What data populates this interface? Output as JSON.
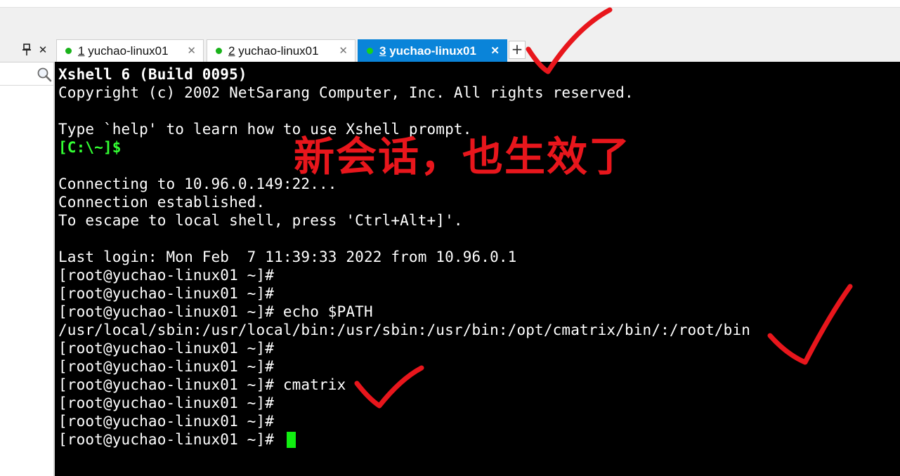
{
  "tabs": [
    {
      "num": "1",
      "label": "yuchao-linux01",
      "active": false
    },
    {
      "num": "2",
      "label": "yuchao-linux01",
      "active": false
    },
    {
      "num": "3",
      "label": "yuchao-linux01",
      "active": true
    }
  ],
  "tab_close_glyph": "✕",
  "add_tab_glyph": "+",
  "left_panel": {
    "pin_glyph": "📌",
    "close_glyph": "✕"
  },
  "terminal": {
    "lines": [
      "Xshell 6 (Build 0095)",
      "Copyright (c) 2002 NetSarang Computer, Inc. All rights reserved.",
      "",
      "Type `help' to learn how to use Xshell prompt.",
      "[C:\\~]$",
      "",
      "Connecting to 10.96.0.149:22...",
      "Connection established.",
      "To escape to local shell, press 'Ctrl+Alt+]'.",
      "",
      "Last login: Mon Feb  7 11:39:33 2022 from 10.96.0.1",
      "[root@yuchao-linux01 ~]#",
      "[root@yuchao-linux01 ~]#",
      "[root@yuchao-linux01 ~]# echo $PATH",
      "/usr/local/sbin:/usr/local/bin:/usr/sbin:/usr/bin:/opt/cmatrix/bin/:/root/bin",
      "[root@yuchao-linux01 ~]#",
      "[root@yuchao-linux01 ~]#",
      "[root@yuchao-linux01 ~]# cmatrix",
      "[root@yuchao-linux01 ~]#",
      "[root@yuchao-linux01 ~]#",
      "[root@yuchao-linux01 ~]#"
    ]
  },
  "annotation": "新会话，也生效了",
  "colors": {
    "active_tab": "#0a84d9",
    "session_dot": "#19b21a",
    "cursor": "#11ee11",
    "annotation": "#e8161c",
    "terminal_bg": "#000000"
  }
}
